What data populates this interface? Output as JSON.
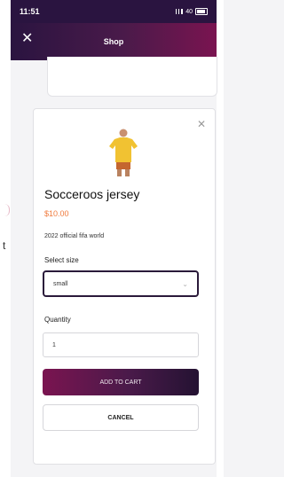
{
  "status": {
    "time": "11:51",
    "signal": "40"
  },
  "header": {
    "close_glyph": "✕",
    "title": "Shop"
  },
  "modal": {
    "close_glyph": "✕",
    "product": {
      "name": "Socceroos jersey",
      "price": "$10.00",
      "description": "2022 official fifa world"
    },
    "size": {
      "label": "Select size",
      "value": "small",
      "chevron": "⌄"
    },
    "quantity": {
      "label": "Quantity",
      "value": "1"
    },
    "add_to_cart_label": "ADD TO CART",
    "cancel_label": "CANCEL"
  },
  "background_marks": {
    "left_char": "t"
  },
  "colors": {
    "header_start": "#2a1440",
    "header_end": "#7a1450",
    "price": "#f07a3c"
  }
}
